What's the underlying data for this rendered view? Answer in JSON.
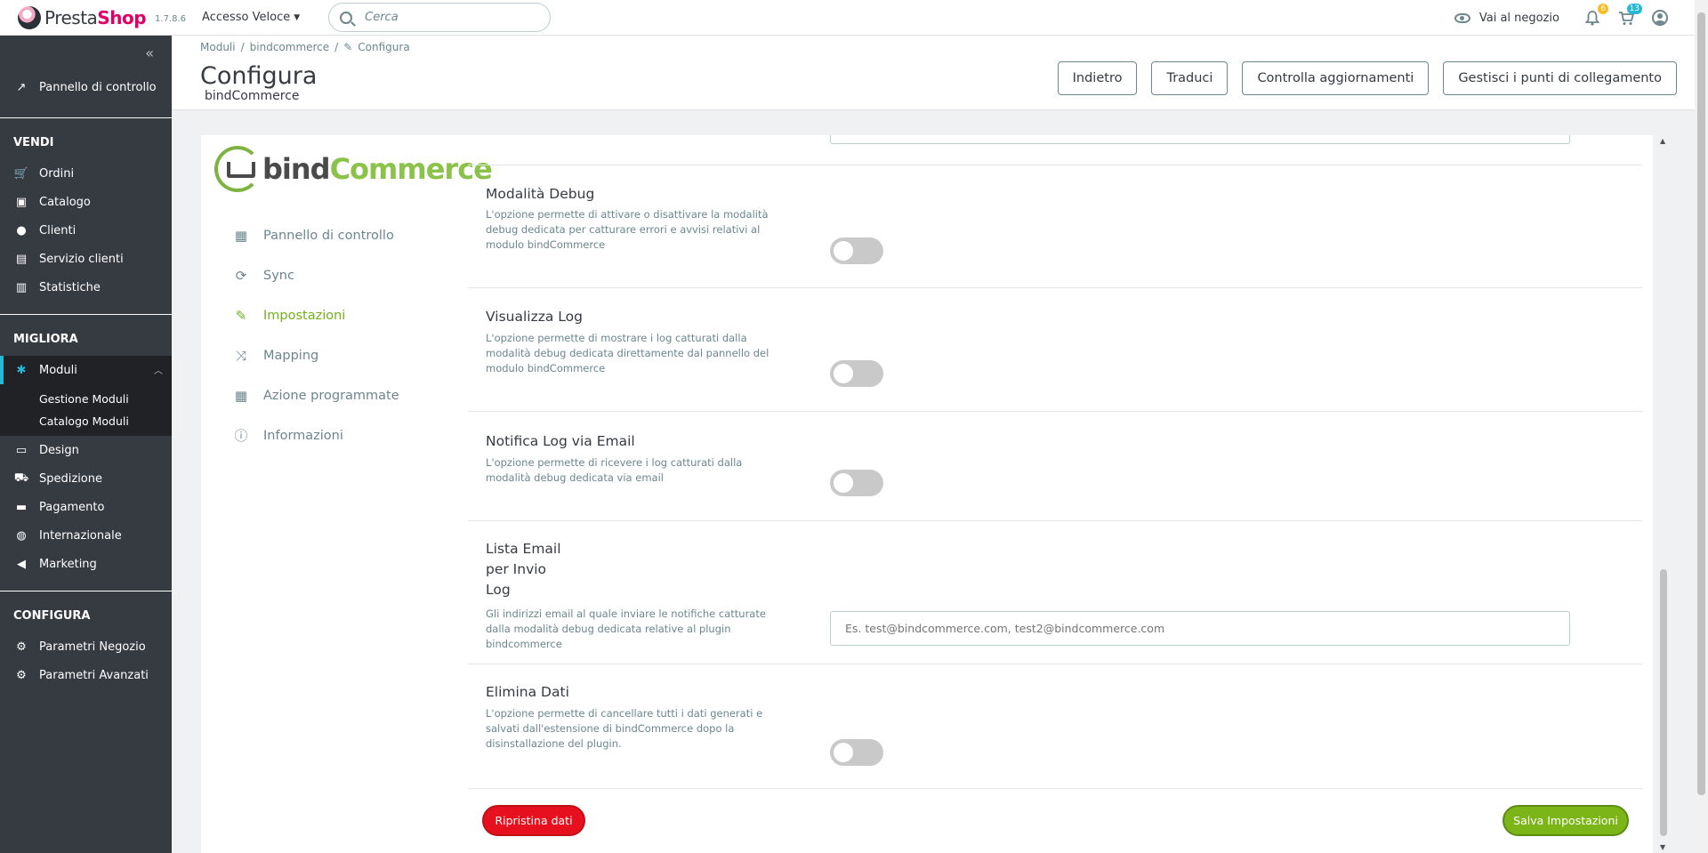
{
  "header": {
    "brand": "PrestaShop",
    "version": "1.7.8.6",
    "quick_access": "Accesso Veloce",
    "search_placeholder": "Cerca",
    "shop_link": "Vai al negozio",
    "notif_orders": "6",
    "notif_customers": "13"
  },
  "sidebar": {
    "dashboard": "Pannello di controllo",
    "sections": {
      "sell": "VENDI",
      "improve": "MIGLIORA",
      "configure": "CONFIGURA"
    },
    "sell_items": [
      "Ordini",
      "Catalogo",
      "Clienti",
      "Servizio clienti",
      "Statistiche"
    ],
    "modules": "Moduli",
    "module_sub": [
      "Gestione Moduli",
      "Catalogo Moduli"
    ],
    "improve_items": [
      "Design",
      "Spedizione",
      "Pagamento",
      "Internazionale",
      "Marketing"
    ],
    "configure_items": [
      "Parametri Negozio",
      "Parametri Avanzati"
    ]
  },
  "page": {
    "breadcrumb": [
      "Moduli",
      "bindcommerce",
      "Configura"
    ],
    "title": "Configura",
    "subtitle": "bindCommerce",
    "buttons": [
      "Indietro",
      "Traduci",
      "Controlla aggiornamenti",
      "Gestisci i punti di collegamento"
    ]
  },
  "module": {
    "logo_a": "bind",
    "logo_b": "Commerce",
    "menu": [
      "Pannello di controllo",
      "Sync",
      "Impostazioni",
      "Mapping",
      "Azione programmate",
      "Informazioni"
    ],
    "settings": [
      {
        "title": "Modalità Debug",
        "desc": "L'opzione permette di attivare o disattivare la modalità debug dedicata per catturare errori e avvisi relativi al modulo bindCommerce"
      },
      {
        "title": "Visualizza Log",
        "desc": "L'opzione permette di mostrare i log catturati dalla modalità debug dedicata direttamente dal pannello del modulo bindCommerce"
      },
      {
        "title": "Notifica Log via Email",
        "desc": "L'opzione permette di ricevere i log catturati dalla modalità debug dedicata via email"
      },
      {
        "title": "Lista Email per Invio Log",
        "desc": "Gli indirizzi email al quale inviare le notifiche catturate dalla modalità debug dedicata relative al plugin bindcommerce",
        "placeholder": "Es. test@bindcommerce.com, test2@bindcommerce.com"
      },
      {
        "title": "Elimina Dati",
        "desc": "L'opzione permette di cancellare tutti i dati generati e salvati dall'estensione di bindCommerce dopo la disinstallazione del plugin."
      }
    ],
    "reset_label": "Ripristina dati",
    "save_label": "Salva Impostazioni"
  }
}
